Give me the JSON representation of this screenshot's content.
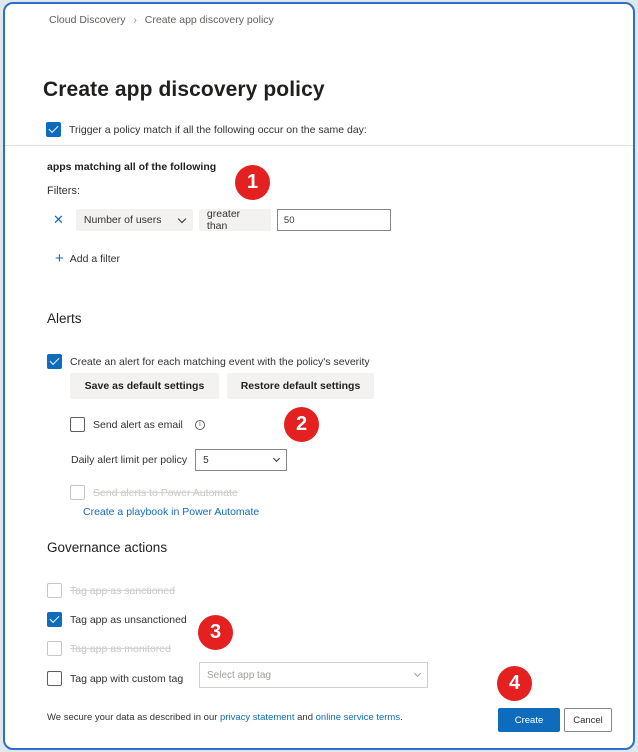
{
  "breadcrumb": {
    "root": "Cloud Discovery",
    "current": "Create app discovery policy"
  },
  "page_title": "Create app discovery policy",
  "trigger": {
    "checked": true,
    "label": "Trigger a policy match if all the following occur on the same day:"
  },
  "filters": {
    "heading": "apps matching all of the following",
    "label": "Filters:",
    "rows": [
      {
        "field": "Number of users",
        "operator": "greater than",
        "value": "50"
      }
    ],
    "add_label": "Add a filter"
  },
  "alerts": {
    "heading": "Alerts",
    "create_alert": {
      "checked": true,
      "label": "Create an alert for each matching event with the policy's severity"
    },
    "save_default_label": "Save as default settings",
    "restore_default_label": "Restore default settings",
    "send_email": {
      "checked": false,
      "label": "Send alert as email"
    },
    "daily_limit_label": "Daily alert limit per policy",
    "daily_limit_value": "5",
    "power_automate": {
      "checked": false,
      "disabled": true,
      "label": "Send alerts to Power Automate"
    },
    "playbook_link": "Create a playbook in Power Automate"
  },
  "governance": {
    "heading": "Governance actions",
    "items": [
      {
        "label": "Tag app as sanctioned",
        "checked": false,
        "disabled": true
      },
      {
        "label": "Tag app as unsanctioned",
        "checked": true,
        "disabled": false
      },
      {
        "label": "Tag app as monitored",
        "checked": false,
        "disabled": true
      },
      {
        "label": "Tag app with custom tag",
        "checked": false,
        "disabled": false
      }
    ],
    "custom_tag_placeholder": "Select app tag"
  },
  "footer": {
    "text_before": "We secure your data as described in our ",
    "privacy_link": "privacy statement",
    "text_middle": " and ",
    "terms_link": "online service terms",
    "text_after": ".",
    "create_label": "Create",
    "cancel_label": "Cancel"
  },
  "markers": [
    "1",
    "2",
    "3",
    "4"
  ],
  "colors": {
    "accent": "#0f6cbd",
    "marker": "#e42020",
    "frame_border": "#2d6fc2"
  }
}
